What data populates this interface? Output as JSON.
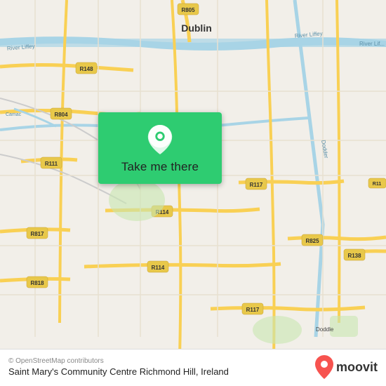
{
  "map": {
    "background_color": "#f2efe9",
    "center_city": "Dublin",
    "attribution": "© OpenStreetMap contributors",
    "location_name": "Saint Mary's Community Centre Richmond Hill,",
    "location_country": "Ireland"
  },
  "button": {
    "label": "Take me there"
  },
  "moovit": {
    "brand_name": "moovit"
  },
  "icons": {
    "pin": "location-pin-icon",
    "moovit_logo": "moovit-logo-icon"
  }
}
